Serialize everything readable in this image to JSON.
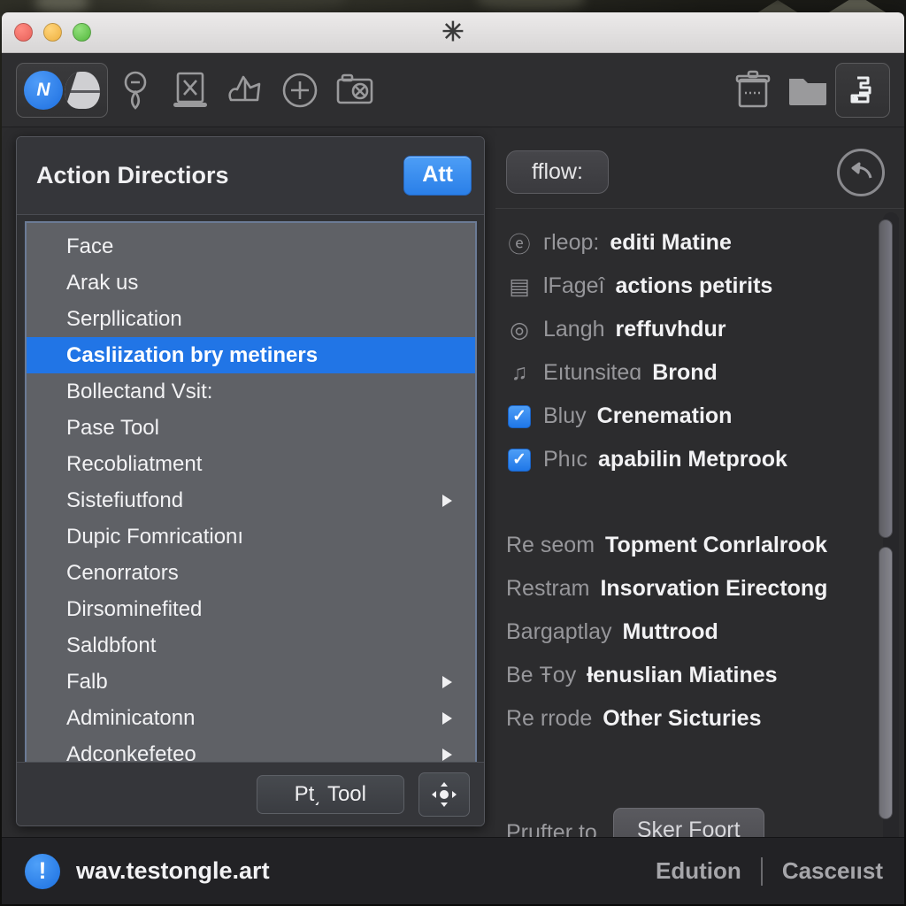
{
  "window": {
    "title_glyph": "✳",
    "traffic_lights": [
      "close",
      "minimize",
      "zoom"
    ]
  },
  "toolbar": {
    "items": [
      {
        "name": "mode-toggle",
        "label": "N"
      },
      {
        "name": "pin-icon",
        "label": ""
      },
      {
        "name": "screen-close-icon",
        "label": ""
      },
      {
        "name": "share-upload-icon",
        "label": ""
      },
      {
        "name": "add-circle-icon",
        "label": ""
      },
      {
        "name": "camera-icon",
        "label": ""
      },
      {
        "name": "archive-icon",
        "label": ""
      },
      {
        "name": "folder-icon",
        "label": ""
      },
      {
        "name": "music-export-icon",
        "label": ""
      }
    ]
  },
  "left_panel": {
    "title": "Action Directiors",
    "action_button": "Att",
    "list": [
      {
        "label": "Face",
        "selected": false,
        "submenu": false
      },
      {
        "label": "Arak us",
        "selected": false,
        "submenu": false
      },
      {
        "label": "Serpllication",
        "selected": false,
        "submenu": false
      },
      {
        "label": "Casliization bry metiners",
        "selected": true,
        "submenu": false
      },
      {
        "label": "Bollectand Vsit:",
        "selected": false,
        "submenu": false
      },
      {
        "label": "Pase Tool",
        "selected": false,
        "submenu": false
      },
      {
        "label": "Recobliatment",
        "selected": false,
        "submenu": false
      },
      {
        "label": "Sistefiutfond",
        "selected": false,
        "submenu": true
      },
      {
        "label": "Dupic Fomricationı",
        "selected": false,
        "submenu": false
      },
      {
        "label": "Cenorrators",
        "selected": false,
        "submenu": false
      },
      {
        "label": "Dirsominefited",
        "selected": false,
        "submenu": false
      },
      {
        "label": "Saldbfont",
        "selected": false,
        "submenu": false
      },
      {
        "label": "Falb",
        "selected": false,
        "submenu": true
      },
      {
        "label": "Adminicatonn",
        "selected": false,
        "submenu": true
      },
      {
        "label": "Adconkefeteo",
        "selected": false,
        "submenu": true
      }
    ],
    "footer_button": "Pt͵ Tool",
    "footer_icon": "move-gear-icon"
  },
  "right_panel": {
    "flow_button": "fflow:",
    "undo_icon": "undo-arrow-icon",
    "rows_top": [
      {
        "icon": "at-icon",
        "glyph": "ⓔ",
        "dim": "гleop:",
        "strong": "editi Matine",
        "checkbox": false
      },
      {
        "icon": "card-icon",
        "glyph": "▤",
        "dim": "lFageî",
        "strong": "actions petirits",
        "checkbox": false
      },
      {
        "icon": "eye-icon",
        "glyph": "◎",
        "dim": "Langh",
        "strong": "reffuvhdur",
        "checkbox": false
      },
      {
        "icon": "music-note-icon",
        "glyph": "♫",
        "dim": "Eıtunsiteɑ",
        "strong": "Brond",
        "checkbox": false
      },
      {
        "icon": "checkbox-checked",
        "glyph": "✓",
        "dim": "Bluy",
        "strong": "Crenemation",
        "checkbox": true
      },
      {
        "icon": "checkbox-checked",
        "glyph": "✓",
        "dim": "Phıc",
        "strong": "apabilin Metprook",
        "checkbox": true
      }
    ],
    "rows_bottom": [
      {
        "dim": "Re seom",
        "strong": "Topment Conrlalrook"
      },
      {
        "dim": "Restram",
        "strong": "Insorvation Eirectong"
      },
      {
        "dim": "Bargaptlay",
        "strong": "Muttrood"
      },
      {
        "dim": "Be Ŧoy",
        "strong": "Ɨenuslian Miatines"
      },
      {
        "dim": "Re rrode",
        "strong": "Other Sicturies"
      }
    ],
    "footer_label": "Prufter to",
    "footer_button": "Sker Foort",
    "scrollbar": "vertical-scrollbar"
  },
  "statusbar": {
    "alert_icon": "!",
    "title": "wav.testongle.art",
    "link_left": "Edution",
    "link_right": "Casceııst"
  },
  "colors": {
    "accent_blue": "#2175e6",
    "window_bg": "#2c2c2e",
    "panel_bg": "#2f3033",
    "list_bg": "#5f6166"
  }
}
